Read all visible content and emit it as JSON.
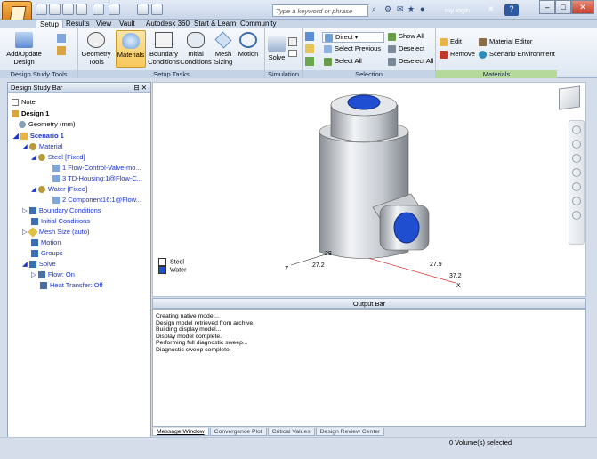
{
  "app": {
    "search_placeholder": "Type a keyword or phrase",
    "user": "my login",
    "help": "?"
  },
  "tabs": [
    "Setup",
    "Results",
    "View",
    "Vault",
    "Autodesk 360",
    "Start & Learn",
    "Community"
  ],
  "ribbon": {
    "design_study_tools": {
      "label": "Design Study Tools",
      "add_update": "Add/Update Design",
      "geometry_tools": "Geometry Tools"
    },
    "setup_tasks": {
      "label": "Setup Tasks",
      "materials": "Materials",
      "boundary": "Boundary Conditions",
      "initial": "Initial Conditions",
      "mesh": "Mesh Sizing",
      "motion": "Motion"
    },
    "simulation": {
      "label": "Simulation",
      "solve": "Solve"
    },
    "selection": {
      "label": "Selection",
      "mode": "Direct",
      "select_previous": "Select Previous",
      "select_all": "Select All",
      "show_all": "Show All",
      "deselect": "Deselect",
      "deselect_all": "Deselect All"
    },
    "materials": {
      "label": "Materials",
      "edit": "Edit",
      "remove": "Remove",
      "material_editor": "Material Editor",
      "scenario_env": "Scenario Environment"
    }
  },
  "design_study": {
    "title": "Design Study Bar",
    "items": [
      "Note",
      "Design 1",
      "Geometry (mm)",
      "Scenario 1",
      "Material",
      "Steel [Fixed]",
      "1 Flow-Control-Valve-mo...",
      "3 TD-Housing:1@Flow-C...",
      "Water [Fixed]",
      "2 Component16:1@Flow...",
      "Boundary Conditions",
      "Initial Conditions",
      "Mesh Size (auto)",
      "Motion",
      "Groups",
      "Solve",
      "Flow: On",
      "Heat Transfer: Off"
    ]
  },
  "viewport": {
    "legend": [
      "Steel",
      "Water"
    ],
    "dims": [
      "27.2",
      "28",
      "27.9",
      "37.2"
    ],
    "axes": [
      "Z",
      "X"
    ]
  },
  "output": {
    "title": "Output Bar",
    "lines": [
      "Creating native model...",
      "Design model retrieved from archive.",
      "Building display model...",
      "Display model complete.",
      "Performing full diagnostic sweep...",
      "Diagnostic sweep complete."
    ],
    "tabs": [
      "Message Window",
      "Convergence Plot",
      "Critical Values",
      "Design Review Center"
    ]
  },
  "status": "0 Volume(s) selected"
}
